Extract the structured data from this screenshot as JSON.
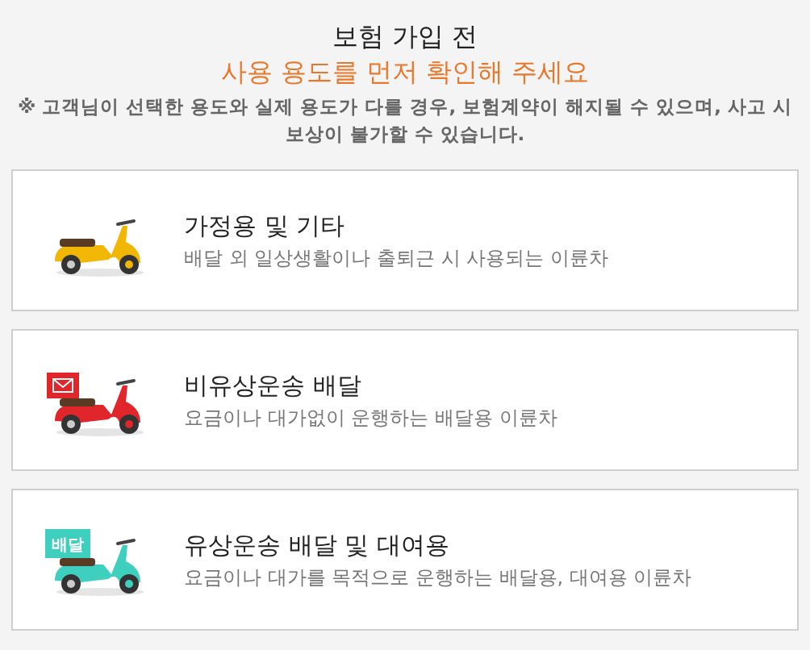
{
  "header": {
    "title": "보험 가입 전",
    "subtitle": "사용 용도를 먼저 확인해 주세요",
    "note": "※ 고객님이 선택한 용도와 실제 용도가 다를 경우, 보험계약이 해지될 수 있으며, 사고 시 보상이 불가할 수 있습니다."
  },
  "options": [
    {
      "kind": "plain",
      "color": "#f2b705",
      "title": "가정용 및 기타",
      "description": "배달 외 일상생활이나 출퇴근 시 사용되는 이륜차"
    },
    {
      "kind": "mail-box",
      "color": "#e0262a",
      "title": "비유상운송 배달",
      "description": "요금이나 대가없이 운행하는 배달용 이륜차"
    },
    {
      "kind": "text-box",
      "color": "#3fcfbf",
      "box_label": "배달",
      "title": "유상운송 배달 및 대여용",
      "description": "요금이나 대가를 목적으로 운행하는 배달용, 대여용 이륜차"
    }
  ]
}
